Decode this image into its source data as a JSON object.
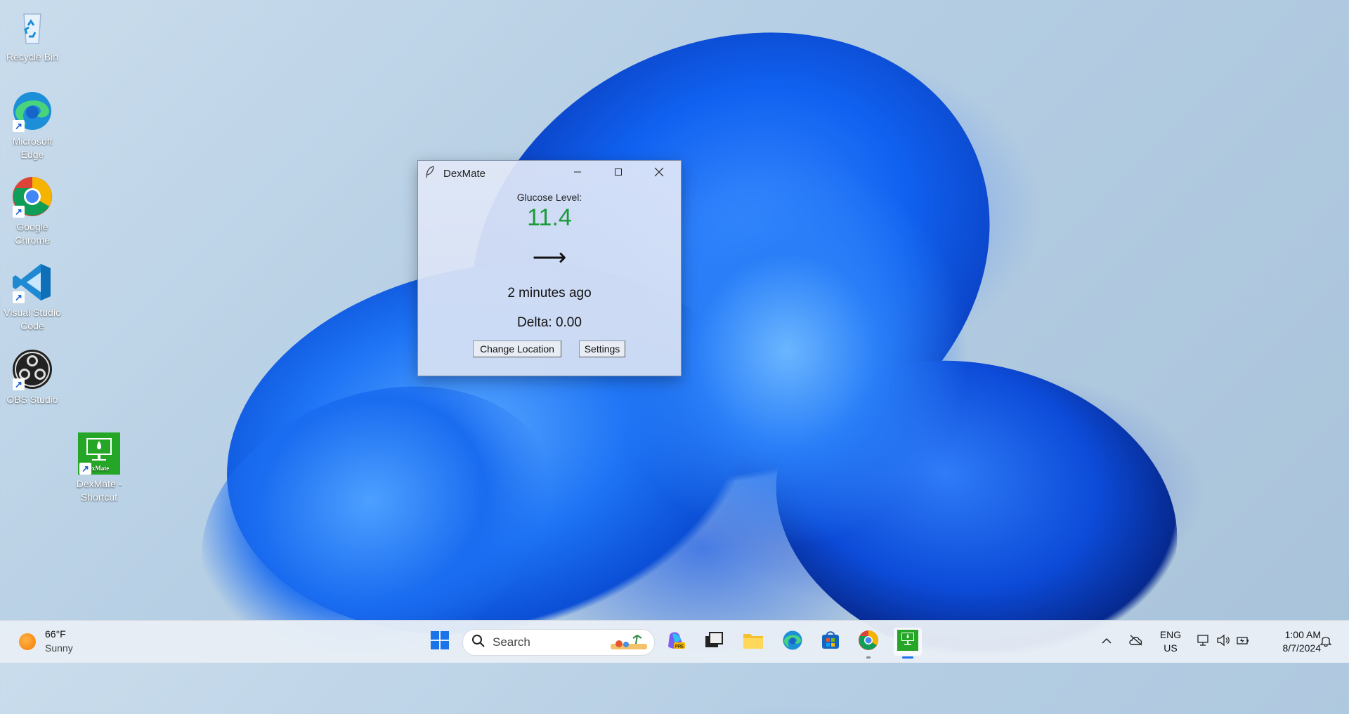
{
  "desktop": {
    "icons": [
      {
        "label": "Recycle Bin"
      },
      {
        "label": "Microsoft Edge"
      },
      {
        "label": "Google Chrome"
      },
      {
        "label": "Visual Studio Code"
      },
      {
        "label": "OBS Studio"
      },
      {
        "label": "DexMate - Shortcut",
        "image_text": "exMate"
      }
    ]
  },
  "window": {
    "title": "DexMate",
    "glucose_label": "Glucose Level:",
    "glucose_value": "11.4",
    "glucose_color": "#1a9a3a",
    "trend_arrow": "⟶",
    "last_update": "2 minutes ago",
    "delta": "Delta: 0.00",
    "buttons": {
      "change_location": "Change Location",
      "settings": "Settings"
    }
  },
  "taskbar": {
    "weather": {
      "temp": "66°F",
      "condition": "Sunny"
    },
    "search_placeholder": "Search",
    "apps": [
      "start-icon",
      "copilot-icon",
      "task-view-icon",
      "file-explorer-icon",
      "edge-icon",
      "store-icon",
      "chrome-icon",
      "dexmate-icon"
    ],
    "tray": {
      "language": "ENG",
      "region": "US",
      "time": "1:00 AM",
      "date": "8/7/2024"
    }
  }
}
